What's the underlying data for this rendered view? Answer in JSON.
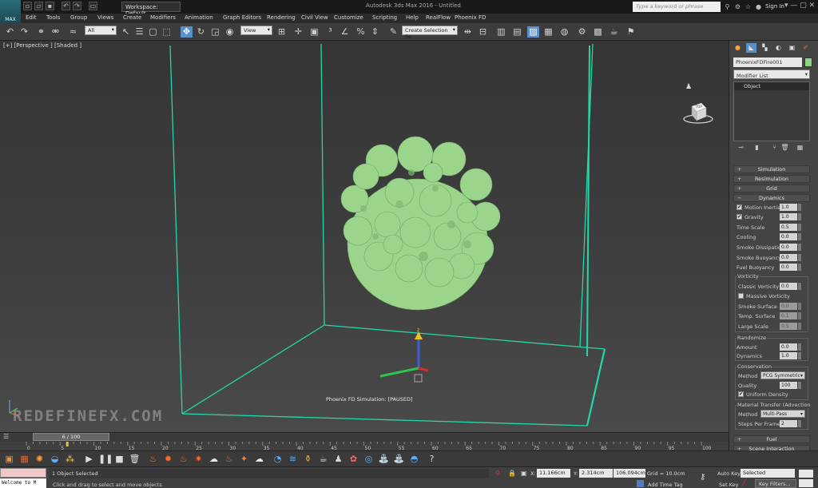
{
  "app": {
    "title": "Autodesk 3ds Max 2016 - Untitled",
    "logo": "MAX",
    "workspace": "Workspace: Default",
    "search_placeholder": "Type a keyword or phrase",
    "sign_in": "Sign In"
  },
  "menu": [
    "Edit",
    "Tools",
    "Group",
    "Views",
    "Create",
    "Modifiers",
    "Animation",
    "Graph Editors",
    "Rendering",
    "Civil View",
    "Customize",
    "Scripting",
    "Help",
    "RealFlow",
    "Phoenix FD"
  ],
  "toolbar": {
    "filter": "All",
    "refcoord": "View",
    "selection_set": "Create Selection Se"
  },
  "viewport": {
    "label": "[+] [Perspective ] [Shaded ]",
    "sim_status": "Phoenix FD Simulation: [PAUSED]",
    "watermark": "REDEFINEFX.COM",
    "navcube_label": "TOP",
    "colors": {
      "grid_box": "#22d8a8",
      "smoke": "#9ad58b"
    }
  },
  "panel": {
    "object_name": "PhoenixFDFire001",
    "object_color": "#8bd484",
    "modifier_list": "Modifier List",
    "stack_item": "Object",
    "rollouts": {
      "simulation": "Simulation",
      "resimulation": "Resimulation",
      "grid": "Grid",
      "dynamics": "Dynamics",
      "fuel": "Fuel",
      "scene_interaction": "Scene Interaction"
    },
    "dynamics": {
      "motion_inertia": {
        "label": "Motion Inertia",
        "value": "1.0",
        "checked": true
      },
      "gravity": {
        "label": "Gravity",
        "value": "1.0",
        "checked": true
      },
      "time_scale": {
        "label": "Time Scale",
        "value": "0.5"
      },
      "cooling": {
        "label": "Cooling",
        "value": "0.0"
      },
      "smoke_dissipation": {
        "label": "Smoke Dissipation",
        "value": "0.0"
      },
      "smoke_buoyancy": {
        "label": "Smoke Buoyancy",
        "value": "0.0"
      },
      "fuel_buoyancy": {
        "label": "Fuel Buoyancy",
        "value": "0.0"
      },
      "vorticity": {
        "title": "Vorticity",
        "classic": {
          "label": "Classic Vorticity",
          "value": "0.0"
        },
        "massive": {
          "label": "Massive Vorticity"
        },
        "smoke_surface": {
          "label": "Smoke Surface",
          "value": "0.0"
        },
        "temp_surface": {
          "label": "Temp. Surface",
          "value": "0.1"
        },
        "large_scale": {
          "label": "Large Scale",
          "value": "0.5"
        }
      },
      "randomize": {
        "title": "Randomize",
        "amount": {
          "label": "Amount",
          "value": "0.0"
        },
        "dynamics": {
          "label": "Dynamics",
          "value": "1.0"
        }
      },
      "conservation": {
        "title": "Conservation",
        "method": {
          "label": "Method",
          "value": "PCG Symmetric"
        },
        "quality": {
          "label": "Quality",
          "value": "100"
        },
        "uniform_density": {
          "label": "Uniform Density",
          "checked": true
        }
      },
      "material_transfer": {
        "title": "Material Transfer (Advection",
        "method": {
          "label": "Method",
          "value": "Multi-Pass"
        },
        "steps": {
          "label": "Steps Per Frame",
          "value": "2"
        }
      }
    }
  },
  "timeline": {
    "slider": "6 / 100",
    "current_frame": 6,
    "start": 0,
    "end": 100,
    "labels": [
      "0",
      "5",
      "10",
      "15",
      "20",
      "25",
      "30",
      "35",
      "40",
      "45",
      "50",
      "55",
      "60",
      "65",
      "70",
      "75",
      "80",
      "85",
      "90",
      "95",
      "100"
    ]
  },
  "status": {
    "welcome": "Welcome to M",
    "selected": "1 Object Selected",
    "prompt": "Click and drag to select and move objects",
    "x_label": "X:",
    "x": "11.166cm",
    "y_label": "Y:",
    "y": "2.314cm",
    "z_label": "Z:",
    "z": "106.094cm",
    "grid": "Grid = 10.0cm",
    "add_time_tag": "Add Time Tag",
    "auto_key": "Auto Key",
    "selected_mode": "Selected",
    "set_key": "Set Key",
    "key_filters": "Key Filters..."
  }
}
